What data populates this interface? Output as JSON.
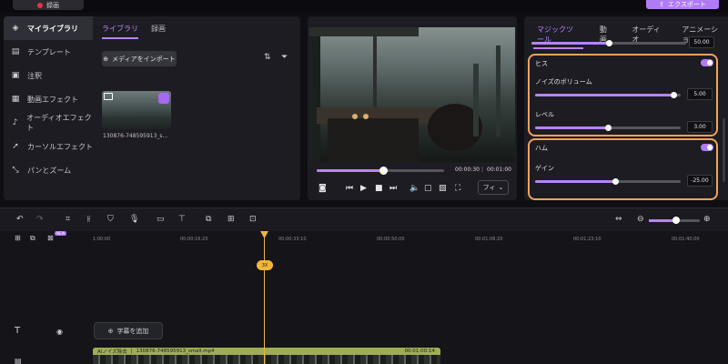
{
  "topbar": {
    "record_label": "録画",
    "export_label": "エクスポート"
  },
  "leftnav": {
    "items": [
      {
        "label": "マイライブラリ",
        "icon": "layers-icon",
        "active": true
      },
      {
        "label": "テンプレート",
        "icon": "template-icon",
        "active": false
      },
      {
        "label": "注釈",
        "icon": "annotation-icon",
        "active": false
      },
      {
        "label": "動画エフェクト",
        "icon": "video-effect-icon",
        "active": false
      },
      {
        "label": "オーディオエフェクト",
        "icon": "audio-effect-icon",
        "active": false
      },
      {
        "label": "カーソルエフェクト",
        "icon": "cursor-effect-icon",
        "active": false
      },
      {
        "label": "パンとズーム",
        "icon": "pan-zoom-icon",
        "active": false
      }
    ]
  },
  "library": {
    "tabs": [
      {
        "label": "ライブラリ",
        "active": true
      },
      {
        "label": "録画",
        "active": false
      }
    ],
    "import_label": "メディアをインポート",
    "media": [
      {
        "name": "130876-748595913_s..."
      }
    ]
  },
  "preview": {
    "progress": 0.52,
    "current_time": "00:00:30",
    "separator": "|",
    "total_time": "00:01:00",
    "fit_label": "フィ"
  },
  "rightpanel": {
    "tabs": [
      {
        "label": "マジックツール",
        "active": true
      },
      {
        "label": "動画",
        "active": false
      },
      {
        "label": "オーディオ",
        "active": false
      },
      {
        "label": "アニメーション",
        "active": false
      }
    ],
    "top_slider": {
      "value": "50.00",
      "level": 0.5
    },
    "hiss": {
      "label": "ヒス",
      "enabled": true,
      "noise_volume_label": "ノイズのボリューム",
      "noise_volume": "5.00",
      "noise_level": 0.95,
      "level_label": "レベル",
      "level": "3.00",
      "level_fill": 0.5
    },
    "hum": {
      "label": "ハム",
      "enabled": true,
      "gain_label": "ゲイン",
      "gain": "-25.00",
      "gain_fill": 0.55
    }
  },
  "timeline": {
    "ruler": [
      "1:00:00",
      "00:00:16:20",
      "00:00:33:10",
      "00:00:50:00",
      "00:01:06:20",
      "00:01:23:10",
      "00:01:40:00"
    ],
    "playhead_badge": "3X",
    "new_badge": "NEW",
    "add_caption_label": "字幕を追加",
    "clip": {
      "effect": "AIノイズ除去",
      "name": "130876-748595913_small.mp4",
      "duration": "00:01:00:14"
    }
  }
}
